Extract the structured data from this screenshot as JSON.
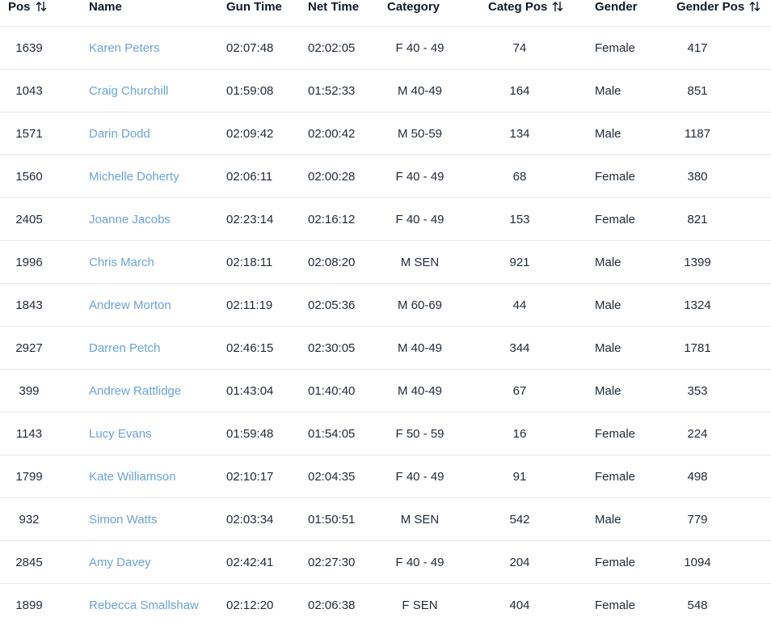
{
  "columns": {
    "pos": "Pos",
    "name": "Name",
    "gun_time": "Gun Time",
    "net_time": "Net Time",
    "category": "Category",
    "categ_pos": "Categ Pos",
    "gender": "Gender",
    "gender_pos": "Gender Pos"
  },
  "sort_icon": "sort-arrows-icon",
  "colors": {
    "link": "#6aa3d9",
    "border": "#e5e7eb",
    "text": "#1f2937"
  },
  "rows": [
    {
      "pos": "1639",
      "name": "Karen Peters",
      "gun": "02:07:48",
      "net": "02:02:05",
      "cat": "F 40 - 49",
      "cpos": "74",
      "gender": "Female",
      "gpos": "417"
    },
    {
      "pos": "1043",
      "name": "Craig Churchill",
      "gun": "01:59:08",
      "net": "01:52:33",
      "cat": "M 40-49",
      "cpos": "164",
      "gender": "Male",
      "gpos": "851"
    },
    {
      "pos": "1571",
      "name": "Darin Dodd",
      "gun": "02:09:42",
      "net": "02:00:42",
      "cat": "M 50-59",
      "cpos": "134",
      "gender": "Male",
      "gpos": "1187"
    },
    {
      "pos": "1560",
      "name": "Michelle Doherty",
      "gun": "02:06:11",
      "net": "02:00:28",
      "cat": "F 40 - 49",
      "cpos": "68",
      "gender": "Female",
      "gpos": "380"
    },
    {
      "pos": "2405",
      "name": "Joanne Jacobs",
      "gun": "02:23:14",
      "net": "02:16:12",
      "cat": "F 40 - 49",
      "cpos": "153",
      "gender": "Female",
      "gpos": "821"
    },
    {
      "pos": "1996",
      "name": "Chris March",
      "gun": "02:18:11",
      "net": "02:08:20",
      "cat": "M SEN",
      "cpos": "921",
      "gender": "Male",
      "gpos": "1399"
    },
    {
      "pos": "1843",
      "name": "Andrew Morton",
      "gun": "02:11:19",
      "net": "02:05:36",
      "cat": "M 60-69",
      "cpos": "44",
      "gender": "Male",
      "gpos": "1324"
    },
    {
      "pos": "2927",
      "name": "Darren Petch",
      "gun": "02:46:15",
      "net": "02:30:05",
      "cat": "M 40-49",
      "cpos": "344",
      "gender": "Male",
      "gpos": "1781"
    },
    {
      "pos": "399",
      "name": "Andrew Rattlidge",
      "gun": "01:43:04",
      "net": "01:40:40",
      "cat": "M 40-49",
      "cpos": "67",
      "gender": "Male",
      "gpos": "353"
    },
    {
      "pos": "1143",
      "name": "Lucy Evans",
      "gun": "01:59:48",
      "net": "01:54:05",
      "cat": "F 50 - 59",
      "cpos": "16",
      "gender": "Female",
      "gpos": "224"
    },
    {
      "pos": "1799",
      "name": "Kate Williamson",
      "gun": "02:10:17",
      "net": "02:04:35",
      "cat": "F 40 - 49",
      "cpos": "91",
      "gender": "Female",
      "gpos": "498"
    },
    {
      "pos": "932",
      "name": "Simon Watts",
      "gun": "02:03:34",
      "net": "01:50:51",
      "cat": "M SEN",
      "cpos": "542",
      "gender": "Male",
      "gpos": "779"
    },
    {
      "pos": "2845",
      "name": "Amy Davey",
      "gun": "02:42:41",
      "net": "02:27:30",
      "cat": "F 40 - 49",
      "cpos": "204",
      "gender": "Female",
      "gpos": "1094"
    },
    {
      "pos": "1899",
      "name": "Rebecca Smallshaw",
      "gun": "02:12:20",
      "net": "02:06:38",
      "cat": "F SEN",
      "cpos": "404",
      "gender": "Female",
      "gpos": "548"
    }
  ]
}
